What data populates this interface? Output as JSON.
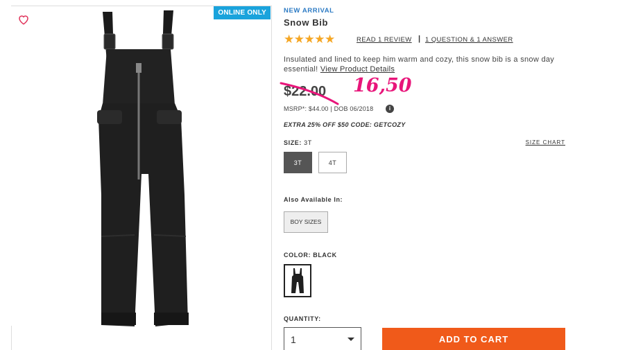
{
  "badge": "ONLINE ONLY",
  "product": {
    "tag": "NEW ARRIVAL",
    "name": "Snow Bib",
    "stars": "★★★★★",
    "rating": 5,
    "review_link": "READ 1 REVIEW",
    "separator": "|",
    "qa_link": "1 QUESTION & 1 ANSWER",
    "description": "Insulated and lined to keep him warm and cozy, this snow bib is a snow day essential!",
    "details_link": "View Product Details",
    "price": "$22.00",
    "handwritten_price": "16,50",
    "msrp": "MSRP*: $44.00 | DOB 06/2018",
    "info_icon": "i",
    "promo": "EXTRA 25% OFF $50 CODE: GETCOZY"
  },
  "size": {
    "label": "SIZE:",
    "value": "3T",
    "chart_link": "SIZE CHART",
    "options": [
      "3T",
      "4T"
    ],
    "selected": "3T"
  },
  "also_available": {
    "label": "Also Available In:",
    "option": "BOY SIZES"
  },
  "color": {
    "label": "COLOR:",
    "value": "BLACK"
  },
  "quantity": {
    "label": "QUANTITY:",
    "value": "1"
  },
  "add_to_cart": "ADD TO CART",
  "colors": {
    "accent_blue": "#1aa3dc",
    "star": "#f5a623",
    "cta": "#f05a1a",
    "handwriting": "#e8157a"
  }
}
